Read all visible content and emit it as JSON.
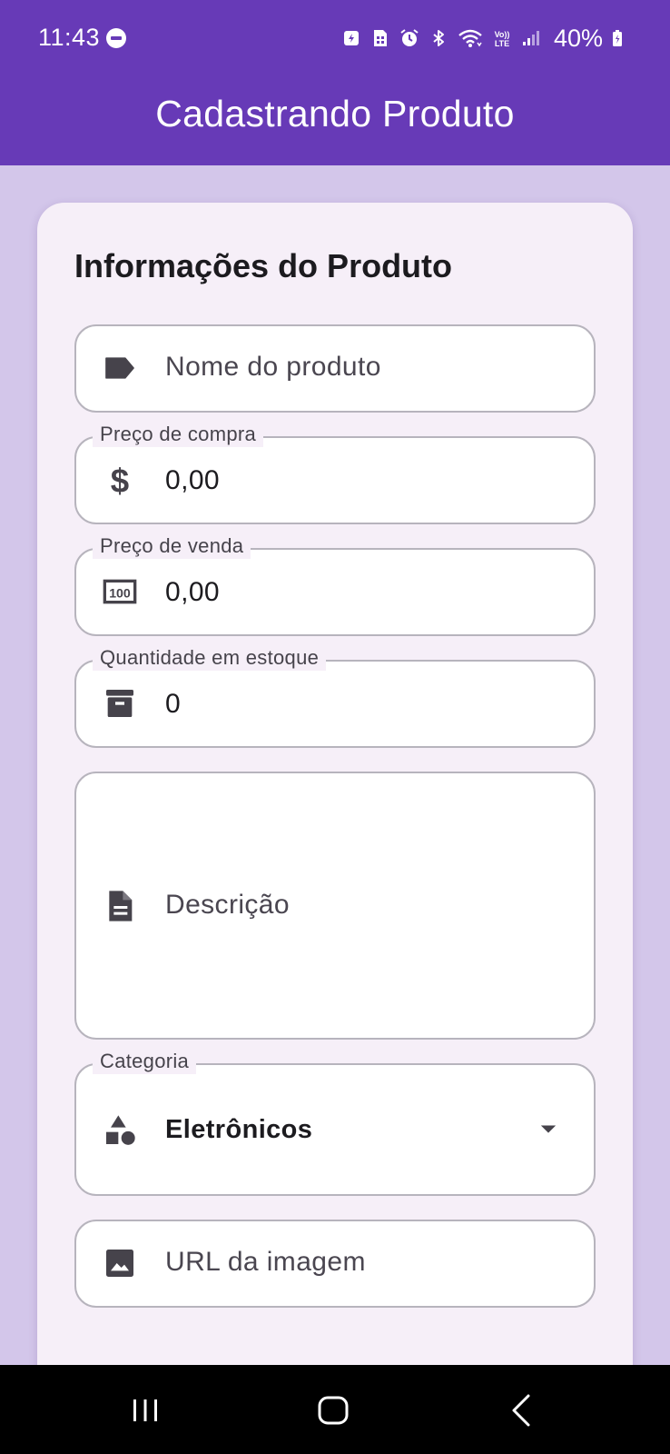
{
  "status_bar": {
    "time": "11:43",
    "battery": "40%",
    "icons": [
      "dnd-icon",
      "battery-saver-icon",
      "sim-icon",
      "alarm-icon",
      "bluetooth-icon",
      "wifi-icon",
      "volte-icon",
      "signal-icon",
      "battery-icon"
    ]
  },
  "app_bar": {
    "title": "Cadastrando Produto",
    "color": "#673ab7"
  },
  "form": {
    "title": "Informações do Produto",
    "name": {
      "placeholder": "Nome do produto",
      "icon": "label-icon"
    },
    "purchase_price": {
      "label": "Preço de compra",
      "value": "0,00",
      "icon": "dollar-icon"
    },
    "sale_price": {
      "label": "Preço de venda",
      "value": "0,00",
      "icon": "money-icon"
    },
    "stock": {
      "label": "Quantidade em estoque",
      "value": "0",
      "icon": "inventory-box-icon"
    },
    "description": {
      "placeholder": "Descrição",
      "icon": "description-icon"
    },
    "category": {
      "label": "Categoria",
      "value": "Eletrônicos",
      "icon": "category-shapes-icon"
    },
    "image_url": {
      "placeholder": "URL da imagem",
      "icon": "image-icon"
    }
  },
  "nav_bar": {
    "icons": [
      "recents-icon",
      "home-icon",
      "back-icon"
    ]
  }
}
